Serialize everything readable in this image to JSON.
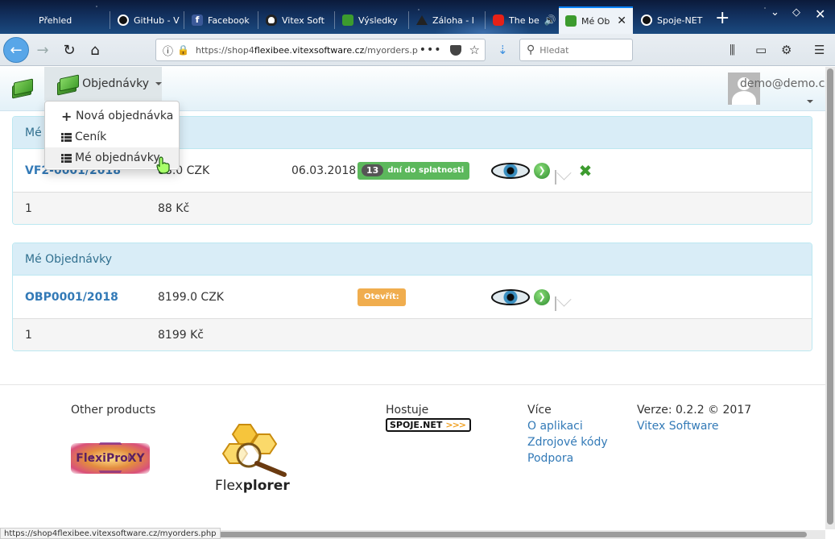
{
  "browser": {
    "tabs": [
      {
        "title": "Přehled",
        "icon": "generic-icon",
        "color": "#3a5a8a"
      },
      {
        "title": "GitHub - V",
        "icon": "github-icon",
        "color": "#111111"
      },
      {
        "title": "Facebook",
        "icon": "facebook-icon",
        "color": "#3b5998"
      },
      {
        "title": "Vitex Soft",
        "icon": "tux-icon",
        "color": "#222222"
      },
      {
        "title": "Výsledky",
        "icon": "money-icon",
        "color": "#3c9b2e"
      },
      {
        "title": "Záloha - l",
        "icon": "mountain-icon",
        "color": "#333333"
      },
      {
        "title": "The be",
        "icon": "youtube-icon",
        "color": "#e62117"
      },
      {
        "title": "Mé Ob",
        "icon": "money-icon",
        "color": "#3c9b2e"
      },
      {
        "title": "Spoje-NET",
        "icon": "github-icon",
        "color": "#111111"
      }
    ],
    "url_prefix": "https://shop4",
    "url_host": "flexibee.vitexsoftware.cz",
    "url_path": "/myorders.p",
    "search_placeholder": "Hledat",
    "status_url": "https://shop4flexibee.vitexsoftware.cz/myorders.php"
  },
  "header": {
    "menu_label": "Objednávky",
    "user_email": "demo@demo.cz"
  },
  "dropdown": {
    "items": [
      {
        "label": "Nová objednávka",
        "icon": "plus-icon"
      },
      {
        "label": "Ceník",
        "icon": "list-icon"
      },
      {
        "label": "Mé objednávky",
        "icon": "list-icon"
      }
    ]
  },
  "panels": [
    {
      "heading": "Mé",
      "doc": "VF2-0001/2018",
      "amount": "88.0 CZK",
      "date": "06.03.2018",
      "badge_num": "13",
      "badge_text": "dní do splatnosti",
      "badge_color": "#5cb85c",
      "sum_count": "1",
      "sum_total": "88 Kč"
    },
    {
      "heading": "Mé Objednávky",
      "doc": "OBP0001/2018",
      "amount": "8199.0 CZK",
      "badge_text": "Otevřít:",
      "badge_color": "#f0ad4e",
      "sum_count": "1",
      "sum_total": "8199 Kč"
    }
  ],
  "footer": {
    "other_products": "Other products",
    "flexiproxy": "FlexiProXY",
    "flexplorer_a": "Flex",
    "flexplorer_b": "plorer",
    "hosted": "Hostuje",
    "spoje": "SPOJE.NET",
    "spoje_arrows": ">>>",
    "more": "Více",
    "links": [
      "O aplikaci",
      "Zdrojové kódy",
      "Podpora"
    ],
    "version": "Verze: 0.2.2 © 2017",
    "company": "Vitex Software"
  }
}
